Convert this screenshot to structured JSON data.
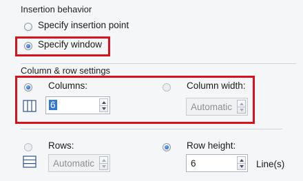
{
  "insertion_behavior": {
    "title": "Insertion behavior",
    "options": [
      {
        "label": "Specify insertion point",
        "selected": false
      },
      {
        "label": "Specify window",
        "selected": true
      }
    ]
  },
  "column_row_settings": {
    "title": "Column & row settings",
    "columns": {
      "label": "Columns:",
      "selected": true,
      "value": "6",
      "icon": "columns-icon"
    },
    "column_width": {
      "label": "Column width:",
      "selected": false,
      "value": "Automatic",
      "disabled": true
    },
    "rows": {
      "label": "Rows:",
      "selected": false,
      "value": "Automatic",
      "disabled": true,
      "icon": "rows-icon"
    },
    "row_height": {
      "label": "Row height:",
      "selected": true,
      "value": "6",
      "unit": "Line(s)"
    }
  },
  "colors": {
    "highlight": "#d6131c",
    "selection": "#3277d8"
  }
}
